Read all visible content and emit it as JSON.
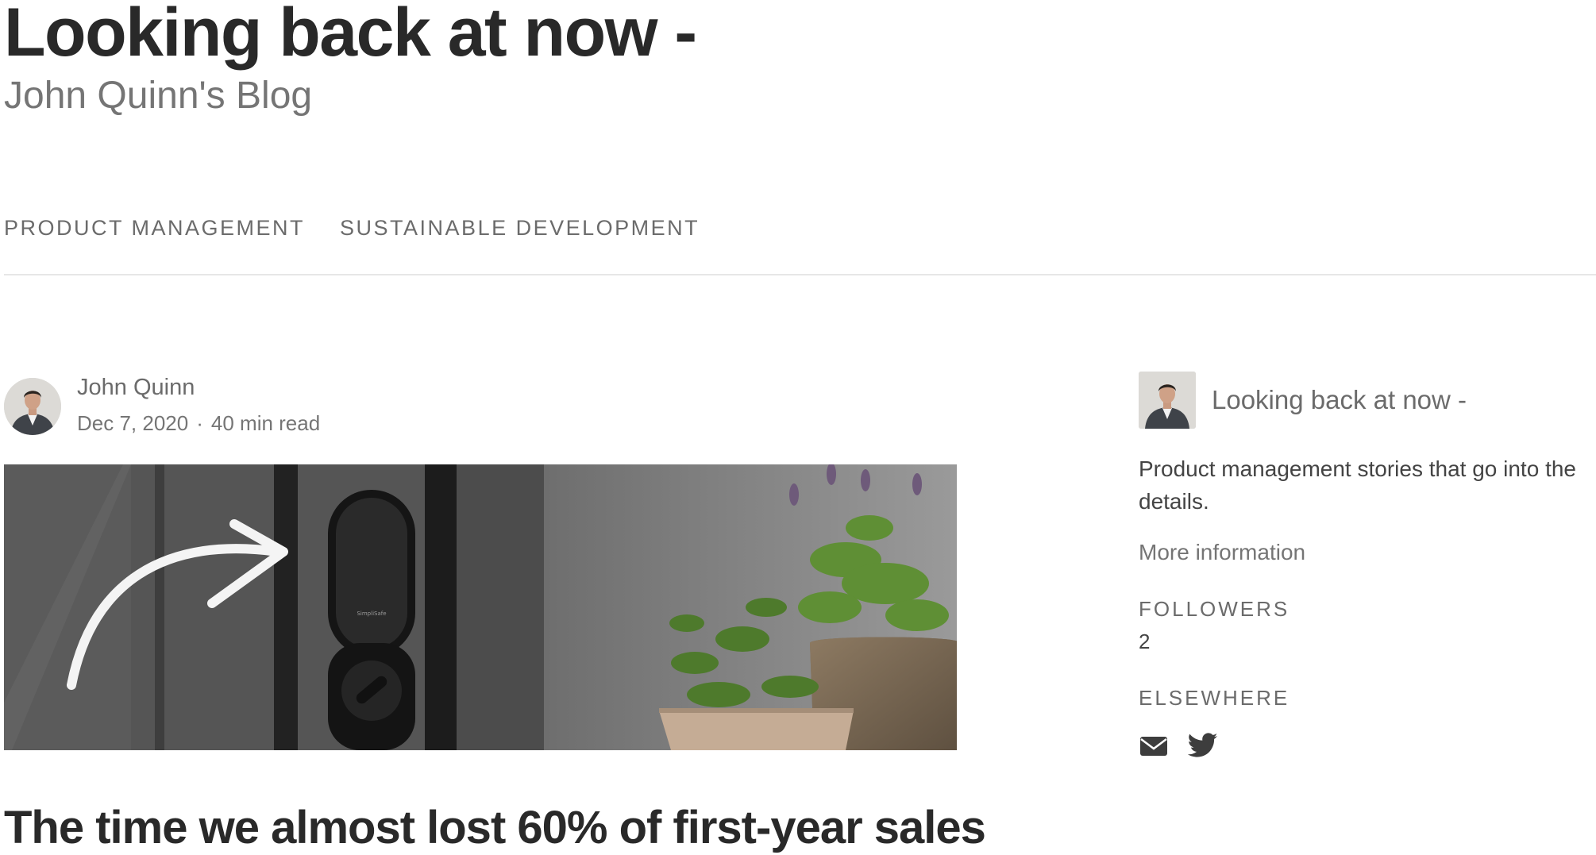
{
  "site": {
    "title": "Looking back at now -",
    "subtitle": "John Quinn's Blog"
  },
  "nav": {
    "items": [
      {
        "label": "PRODUCT MANAGEMENT"
      },
      {
        "label": "SUSTAINABLE DEVELOPMENT"
      }
    ]
  },
  "post": {
    "author": "John Quinn",
    "date": "Dec 7, 2020",
    "separator": "·",
    "read_time": "40 min read",
    "image_text": "SimpliSafe",
    "title": "The time we almost lost 60% of first-year sales"
  },
  "sidebar": {
    "name": "Looking back at now -",
    "description": "Product management stories that go into the details.",
    "more_link": "More information",
    "followers_label": "FOLLOWERS",
    "followers_count": "2",
    "elsewhere_label": "ELSEWHERE",
    "icons": [
      "email-icon",
      "twitter-icon"
    ]
  },
  "colors": {
    "text_primary": "#292929",
    "text_secondary": "#757575",
    "divider": "#e6e6e6",
    "icon": "#3d3d3d"
  }
}
